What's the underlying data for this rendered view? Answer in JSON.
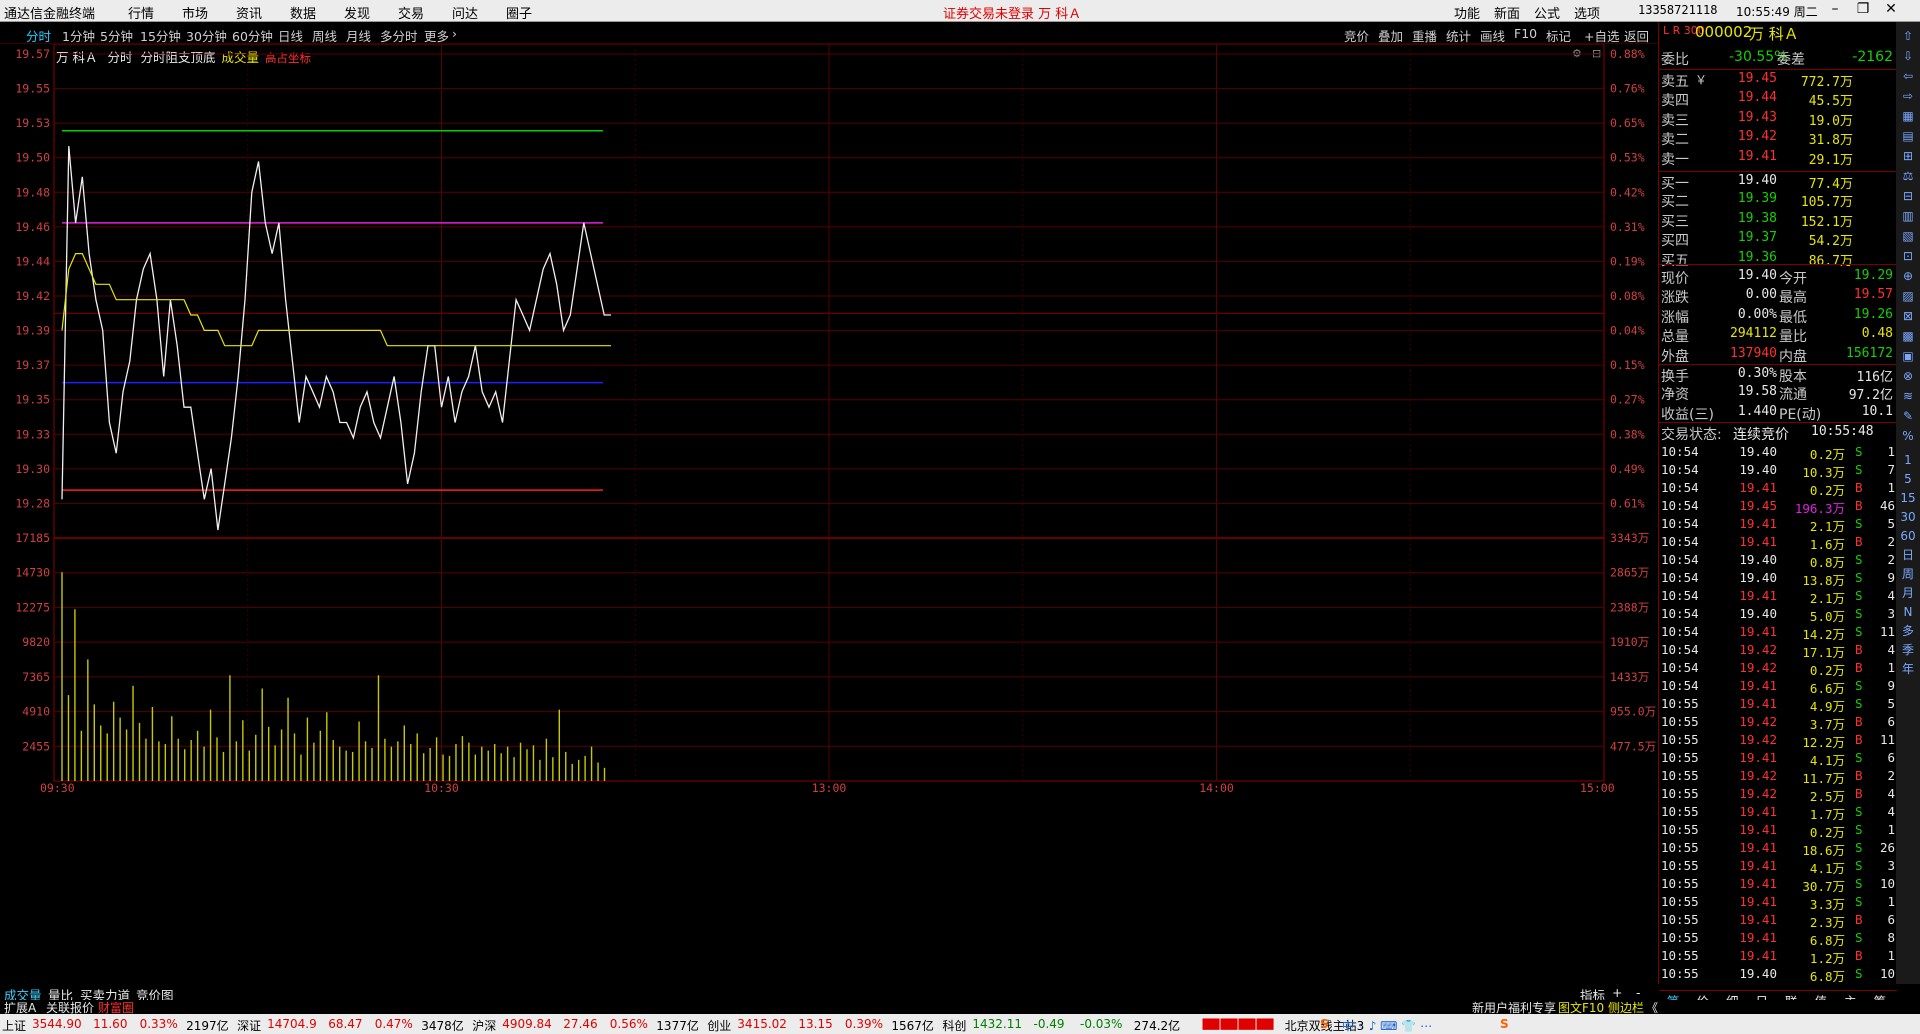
{
  "menubar": {
    "app_title": "通达信金融终端",
    "menus": [
      "行情",
      "市场",
      "资讯",
      "数据",
      "发现",
      "交易",
      "问达",
      "圈子"
    ],
    "center_notice": "证券交易未登录  万 科Ａ",
    "right_items": [
      "功能",
      "新面",
      "公式",
      "选项"
    ],
    "phone": "13358721118",
    "clock": "10:55:49 周二"
  },
  "periodbar": {
    "tabs": [
      "分时",
      "1分钟",
      "5分钟",
      "15分钟",
      "30分钟",
      "60分钟",
      "日线",
      "周线",
      "月线",
      "多分时",
      "更多"
    ],
    "active": "分时",
    "right_tools": [
      "竞价",
      "叠加",
      "重播",
      "统计",
      "画线",
      "F10",
      "标记",
      "+自选",
      "返回"
    ]
  },
  "chart_header": {
    "stock_name": "万 科Ａ",
    "indicators": [
      "分时",
      "分时阻支顶底"
    ],
    "volume_label": "成交量",
    "extra_label": "高占坐标"
  },
  "chart_data": {
    "type": "line",
    "price_axis": [
      "19.57",
      "19.55",
      "19.53",
      "19.50",
      "19.48",
      "19.46",
      "19.44",
      "19.42",
      "19.39",
      "19.37",
      "19.35",
      "19.33",
      "19.30",
      "19.28"
    ],
    "pct_axis": [
      "0.88%",
      "0.76%",
      "0.65%",
      "0.53%",
      "0.42%",
      "0.31%",
      "0.19%",
      "0.08%",
      "0.04%",
      "0.15%",
      "0.27%",
      "0.38%",
      "0.49%",
      "0.61%"
    ],
    "vol_axis_left": [
      "17185",
      "14730",
      "12275",
      "9820",
      "7365",
      "4910",
      "2455"
    ],
    "vol_axis_right": [
      "3343万",
      "2865万",
      "2388万",
      "1910万",
      "1433万",
      "955.0万",
      "477.5万"
    ],
    "time_axis": [
      "09:30",
      "10:30",
      "13:00",
      "14:00",
      "15:00"
    ],
    "ylim": [
      19.27,
      19.58
    ],
    "prev_close": 19.4,
    "reference_lines": [
      {
        "value": 19.53,
        "color": "#00d000"
      },
      {
        "value": 19.47,
        "color": "#e020e0"
      },
      {
        "value": 19.366,
        "color": "#2020ff"
      },
      {
        "value": 19.296,
        "color": "#ff2020"
      }
    ],
    "minutes_total": 240,
    "price": [
      19.29,
      19.52,
      19.47,
      19.5,
      19.45,
      19.42,
      19.4,
      19.34,
      19.32,
      19.36,
      19.38,
      19.42,
      19.44,
      19.45,
      19.42,
      19.37,
      19.42,
      19.39,
      19.35,
      19.35,
      19.32,
      19.29,
      19.31,
      19.27,
      19.3,
      19.33,
      19.37,
      19.42,
      19.49,
      19.51,
      19.47,
      19.45,
      19.47,
      19.42,
      19.38,
      19.34,
      19.37,
      19.36,
      19.35,
      19.37,
      19.36,
      19.34,
      19.34,
      19.33,
      19.35,
      19.36,
      19.34,
      19.33,
      19.35,
      19.37,
      19.34,
      19.3,
      19.32,
      19.36,
      19.39,
      19.39,
      19.35,
      19.37,
      19.34,
      19.36,
      19.37,
      19.39,
      19.36,
      19.35,
      19.36,
      19.34,
      19.38,
      19.42,
      19.41,
      19.4,
      19.42,
      19.44,
      19.45,
      19.43,
      19.4,
      19.41,
      19.44,
      19.47,
      19.45,
      19.43,
      19.41,
      19.41
    ],
    "avg_price": [
      19.4,
      19.44,
      19.45,
      19.45,
      19.44,
      19.43,
      19.43,
      19.43,
      19.42,
      19.42,
      19.42,
      19.42,
      19.42,
      19.42,
      19.42,
      19.42,
      19.42,
      19.42,
      19.42,
      19.41,
      19.41,
      19.4,
      19.4,
      19.4,
      19.39,
      19.39,
      19.39,
      19.39,
      19.39,
      19.4,
      19.4,
      19.4,
      19.4,
      19.4,
      19.4,
      19.4,
      19.4,
      19.4,
      19.4,
      19.4,
      19.4,
      19.4,
      19.4,
      19.4,
      19.4,
      19.4,
      19.4,
      19.4,
      19.39,
      19.39,
      19.39,
      19.39,
      19.39,
      19.39,
      19.39,
      19.39,
      19.39,
      19.39,
      19.39,
      19.39,
      19.39,
      19.39,
      19.39,
      19.39,
      19.39,
      19.39,
      19.39,
      19.39,
      19.39,
      19.39,
      19.39,
      19.39,
      19.39,
      19.39,
      19.39,
      19.39,
      19.39,
      19.39,
      19.39,
      19.39,
      19.39,
      19.39
    ],
    "volume": [
      15800,
      6500,
      13000,
      3800,
      9200,
      5800,
      4200,
      3600,
      6000,
      4800,
      3900,
      7200,
      4400,
      3200,
      5600,
      3000,
      2800,
      4900,
      3200,
      2400,
      3100,
      3800,
      2600,
      5400,
      3300,
      2200,
      8000,
      3000,
      4600,
      2300,
      3500,
      7000,
      4100,
      2700,
      3900,
      6300,
      3600,
      2000,
      4800,
      2900,
      3800,
      5200,
      3100,
      2600,
      2300,
      2200,
      4500,
      3000,
      2500,
      8000,
      3200,
      2600,
      3000,
      4200,
      2800,
      3600,
      2100,
      2500,
      3300,
      2000,
      1900,
      2800,
      3400,
      2900,
      2000,
      2600,
      2300,
      2800,
      2100,
      2600,
      1800,
      2900,
      2400,
      2700,
      1600,
      3200,
      1800,
      5400,
      2200,
      1300,
      1600,
      1900,
      2600,
      1400,
      1000
    ]
  },
  "quote_panel": {
    "code_badge": "L R 300",
    "code": "000002",
    "name": "万 科Ａ",
    "weibi_label": "委比",
    "weibi": "-30.55%",
    "weicha_label": "委差",
    "weicha": "-2162",
    "sell": [
      {
        "label": "卖五",
        "price": "19.45",
        "vol": "772.7万",
        "flag": "￥"
      },
      {
        "label": "卖四",
        "price": "19.44",
        "vol": "45.5万"
      },
      {
        "label": "卖三",
        "price": "19.43",
        "vol": "19.0万"
      },
      {
        "label": "卖二",
        "price": "19.42",
        "vol": "31.8万"
      },
      {
        "label": "卖一",
        "price": "19.41",
        "vol": "29.1万"
      }
    ],
    "buy": [
      {
        "label": "买一",
        "price": "19.40",
        "vol": "77.4万"
      },
      {
        "label": "买二",
        "price": "19.39",
        "vol": "105.7万"
      },
      {
        "label": "买三",
        "price": "19.38",
        "vol": "152.1万"
      },
      {
        "label": "买四",
        "price": "19.37",
        "vol": "54.2万"
      },
      {
        "label": "买五",
        "price": "19.36",
        "vol": "86.7万"
      }
    ],
    "stats": [
      {
        "l1": "现价",
        "v1": "19.40",
        "c1": "w",
        "l2": "今开",
        "v2": "19.29",
        "c2": "g"
      },
      {
        "l1": "涨跌",
        "v1": "0.00",
        "c1": "w",
        "l2": "最高",
        "v2": "19.57",
        "c2": "r"
      },
      {
        "l1": "涨幅",
        "v1": "0.00%",
        "c1": "w",
        "l2": "最低",
        "v2": "19.26",
        "c2": "g"
      },
      {
        "l1": "总量",
        "v1": "294112",
        "c1": "y",
        "l2": "量比",
        "v2": "0.48",
        "c2": "y"
      },
      {
        "l1": "外盘",
        "v1": "137940",
        "c1": "r",
        "l2": "内盘",
        "v2": "156172",
        "c2": "g"
      },
      {
        "l1": "换手",
        "v1": "0.30%",
        "c1": "w",
        "l2": "股本",
        "v2": "116亿",
        "c2": "w"
      },
      {
        "l1": "净资",
        "v1": "19.58",
        "c1": "w",
        "l2": "流通",
        "v2": "97.2亿",
        "c2": "w"
      },
      {
        "l1": "收益(三)",
        "v1": "1.440",
        "c1": "w",
        "l2": "PE(动)",
        "v2": "10.1",
        "c2": "w"
      }
    ],
    "trade_status_label": "交易状态:",
    "trade_status": "连续竞价",
    "trade_time": "10:55:48",
    "ticks": [
      {
        "t": "10:54",
        "p": "19.40",
        "v": "0.2万",
        "s": "S",
        "n": "1"
      },
      {
        "t": "10:54",
        "p": "19.40",
        "v": "10.3万",
        "s": "S",
        "n": "7"
      },
      {
        "t": "10:54",
        "p": "19.41",
        "v": "0.2万",
        "s": "B",
        "n": "1"
      },
      {
        "t": "10:54",
        "p": "19.45",
        "v": "196.3万",
        "s": "B",
        "n": "46"
      },
      {
        "t": "10:54",
        "p": "19.41",
        "v": "2.1万",
        "s": "S",
        "n": "5"
      },
      {
        "t": "10:54",
        "p": "19.41",
        "v": "1.6万",
        "s": "B",
        "n": "2"
      },
      {
        "t": "10:54",
        "p": "19.40",
        "v": "0.8万",
        "s": "S",
        "n": "2"
      },
      {
        "t": "10:54",
        "p": "19.40",
        "v": "13.8万",
        "s": "S",
        "n": "9"
      },
      {
        "t": "10:54",
        "p": "19.41",
        "v": "2.1万",
        "s": "S",
        "n": "4"
      },
      {
        "t": "10:54",
        "p": "19.40",
        "v": "5.0万",
        "s": "S",
        "n": "3"
      },
      {
        "t": "10:54",
        "p": "19.41",
        "v": "14.2万",
        "s": "S",
        "n": "11"
      },
      {
        "t": "10:54",
        "p": "19.42",
        "v": "17.1万",
        "s": "B",
        "n": "4"
      },
      {
        "t": "10:54",
        "p": "19.42",
        "v": "0.2万",
        "s": "B",
        "n": "1"
      },
      {
        "t": "10:54",
        "p": "19.41",
        "v": "6.6万",
        "s": "S",
        "n": "9"
      },
      {
        "t": "10:55",
        "p": "19.41",
        "v": "4.9万",
        "s": "S",
        "n": "5"
      },
      {
        "t": "10:55",
        "p": "19.42",
        "v": "3.7万",
        "s": "B",
        "n": "6"
      },
      {
        "t": "10:55",
        "p": "19.42",
        "v": "12.2万",
        "s": "B",
        "n": "11"
      },
      {
        "t": "10:55",
        "p": "19.41",
        "v": "4.1万",
        "s": "S",
        "n": "6"
      },
      {
        "t": "10:55",
        "p": "19.42",
        "v": "11.7万",
        "s": "B",
        "n": "2"
      },
      {
        "t": "10:55",
        "p": "19.42",
        "v": "2.5万",
        "s": "B",
        "n": "4"
      },
      {
        "t": "10:55",
        "p": "19.41",
        "v": "1.7万",
        "s": "S",
        "n": "4"
      },
      {
        "t": "10:55",
        "p": "19.41",
        "v": "0.2万",
        "s": "S",
        "n": "1"
      },
      {
        "t": "10:55",
        "p": "19.41",
        "v": "18.6万",
        "s": "S",
        "n": "26"
      },
      {
        "t": "10:55",
        "p": "19.41",
        "v": "4.1万",
        "s": "S",
        "n": "3"
      },
      {
        "t": "10:55",
        "p": "19.41",
        "v": "30.7万",
        "s": "S",
        "n": "10"
      },
      {
        "t": "10:55",
        "p": "19.41",
        "v": "3.3万",
        "s": "S",
        "n": "1"
      },
      {
        "t": "10:55",
        "p": "19.41",
        "v": "2.3万",
        "s": "B",
        "n": "6"
      },
      {
        "t": "10:55",
        "p": "19.41",
        "v": "6.8万",
        "s": "S",
        "n": "8"
      },
      {
        "t": "10:55",
        "p": "19.41",
        "v": "1.2万",
        "s": "B",
        "n": "1"
      },
      {
        "t": "10:55",
        "p": "19.40",
        "v": "6.8万",
        "s": "S",
        "n": "10"
      }
    ],
    "bottom_tabs": [
      "笔",
      "价",
      "细",
      "日",
      "联",
      "值",
      "主",
      "筹"
    ]
  },
  "right_strip_labels": [
    "1",
    "5",
    "15",
    "30",
    "60",
    "日",
    "周",
    "月",
    "N",
    "多",
    "季",
    "年"
  ],
  "bottom_tabs": {
    "row1": [
      "成交量",
      "量比",
      "买卖力道",
      "竞价图"
    ],
    "row1_right": [
      "指标",
      "+",
      "-"
    ],
    "row2": [
      "扩展A",
      "关联报价",
      "财富圈"
    ],
    "row2_right": [
      "新用户福利专享",
      "图文F10",
      "侧边栏",
      "《"
    ]
  },
  "statusbar": {
    "items": [
      {
        "name": "上证",
        "val": "3544.90",
        "chg": "11.60",
        "pct": "0.33%",
        "amt": "2197亿",
        "color": "r"
      },
      {
        "name": "深证",
        "val": "14704.9",
        "chg": "68.47",
        "pct": "0.47%",
        "amt": "3478亿",
        "color": "r"
      },
      {
        "name": "沪深",
        "val": "4909.84",
        "chg": "27.46",
        "pct": "0.56%",
        "amt": "1377亿",
        "color": "r"
      },
      {
        "name": "创业",
        "val": "3415.02",
        "chg": "13.15",
        "pct": "0.39%",
        "amt": "1567亿",
        "color": "r"
      },
      {
        "name": "科创",
        "val": "1432.11",
        "chg": "-0.49",
        "pct": "-0.03%",
        "amt": "274.2亿",
        "color": "g"
      }
    ],
    "server": "北京双线主站3"
  }
}
